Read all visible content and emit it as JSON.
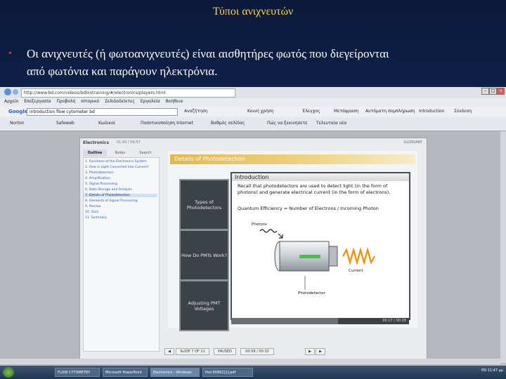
{
  "slide": {
    "title": "Τύποι ανιχνευτών",
    "bullet_line1": "Οι ανιχνευτές (ή φωτοανιχνευτές) είναι αισθητήρες φωτός που διεγείρονται",
    "bullet_line2": "από φωτόνια και παράγουν ηλεκτρόνια."
  },
  "browser": {
    "url": "http://www.bd.com/videos/bdbiotraining/#/electronics/players.html",
    "menu": [
      "Αρχείο",
      "Επεξεργασία",
      "Προβολή",
      "Ιστορικό",
      "Σελιδοδείκτες",
      "Εργαλεία",
      "Βοήθεια"
    ],
    "google_label": "Google",
    "search_value": "introduction flow cytometer bd",
    "toolbar_items": [
      "Αναζήτηση",
      "Κοινή χρήση",
      "Έλεγχος",
      "Μετάφραση",
      "Αυτόματη συμπλήρωση",
      "Introduction",
      "Σύνδεση"
    ],
    "bookmarks": [
      "Norton",
      "Safeweb",
      "Κωδικοί",
      "Ποσοτικοποίηση Internet",
      "Βαθμός σελίδας"
    ],
    "bookmarks2": [
      "Πώς να ξεκινήσετε",
      "Τελευταία νέα"
    ]
  },
  "player": {
    "title": "Electronics",
    "time": "01:43 / 06:57",
    "glossary": "GLOSSARY",
    "tabs": [
      "Outline",
      "Notes",
      "Search"
    ],
    "outline": [
      "1. Functions of the Electronics System",
      "2. How is Light Converted into Current?",
      "3. Photodetectors",
      "4. Amplification",
      "5. Signal Processing",
      "6. Data Storage and Analysis",
      "7. Details of Photodetection",
      "8. Elements of Signal Processing",
      "9. Review",
      "10. Quiz",
      "11. Summary"
    ],
    "banner": "Details of Photodetection",
    "side_boxes": [
      "Types of Photodetectors",
      "How Do PMTs Work?",
      "Adjusting PMT Voltages"
    ],
    "intro_heading": "Introduction",
    "intro_text": "Recall that photodetectors are used to detect light (in the form of photons) and generate electrical current (in the form of electrons).",
    "qe_text": "Quantum Efficiency = Number of Electrons / Incoming Photon",
    "label_photons": "Photons",
    "label_current": "Current",
    "label_photodetector": "Photodetector",
    "progress_time": "00:17 / 00:28",
    "progress_fraction": 0.6,
    "nav_slide": "SLIDE 7 OF 11",
    "nav_status": "PAUSED",
    "nav_time": "00:58 / 00:32"
  },
  "taskbar": {
    "items": [
      "FLOW CYTOMETRY",
      "Microsoft PowerPoint",
      "Electronics - Windows",
      "Ped 80862[1].pdf"
    ],
    "tray": "EN 11:47 μμ"
  },
  "colors": {
    "title_yellow": "#ffd23c",
    "bullet_red": "#e23b2c",
    "banner_gold": "#e3b84a",
    "lamp_green": "#3ec83e",
    "wave_orange": "#ff8a00"
  }
}
